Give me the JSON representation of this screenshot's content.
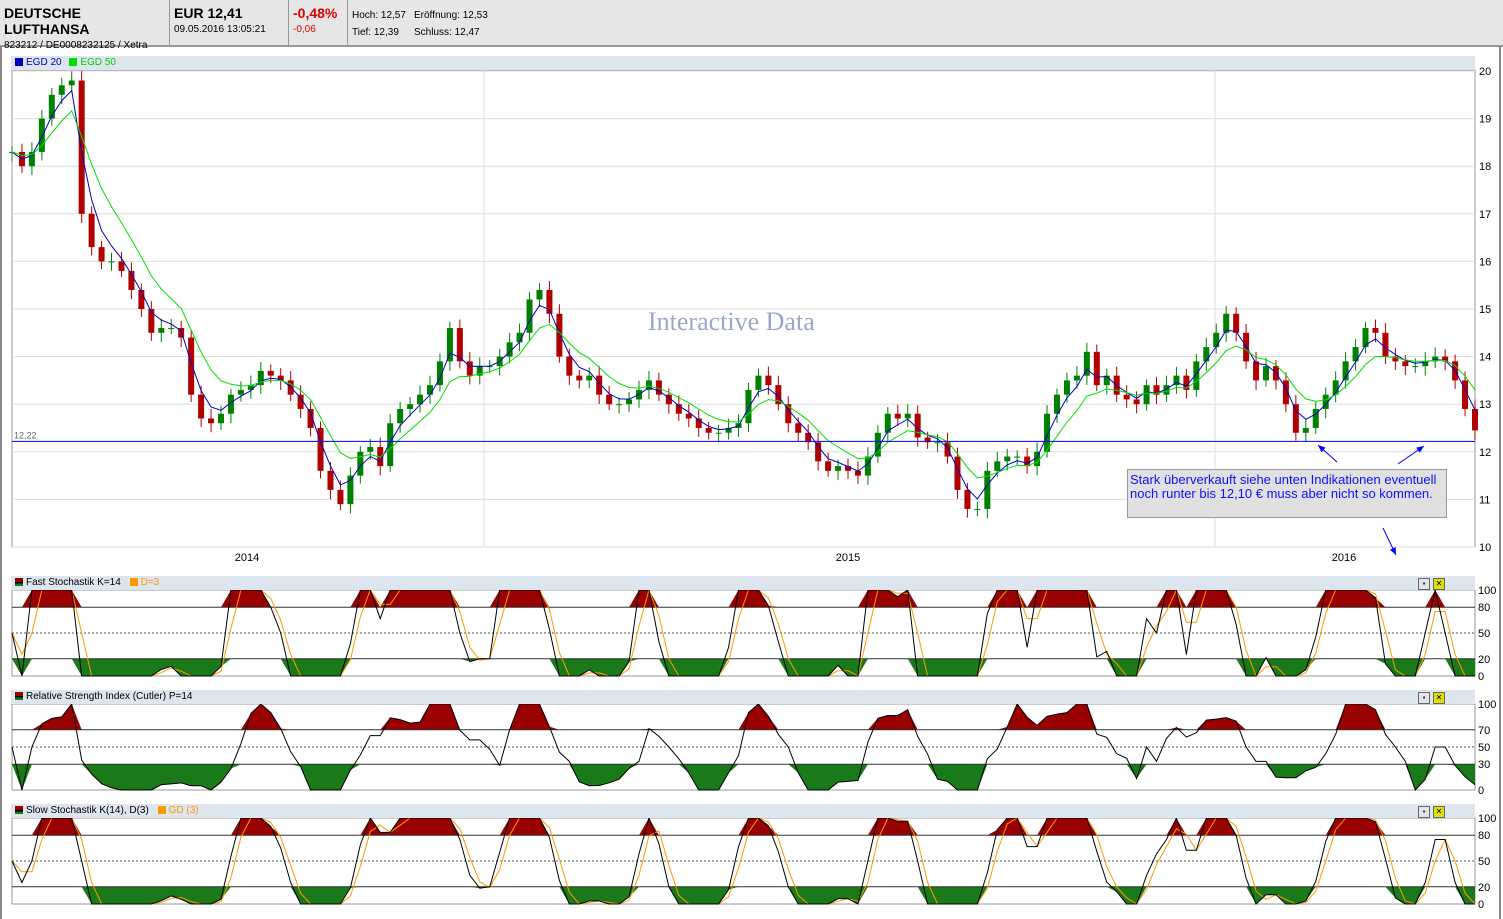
{
  "header": {
    "name": "DEUTSCHE LUFTHANSA",
    "ids": "823212 / DE0008232125 / Xetra",
    "price": "EUR 12,41",
    "datetime": "09.05.2016 13:05:21",
    "change_pct": "-0,48%",
    "change_abs": "-0,06",
    "hoch": "Hoch: 12,57",
    "tief": "Tief: 12,39",
    "eroeffnung": "Eröffnung: 12,53",
    "schluss": "Schluss: 12,47"
  },
  "watermark": "Interactive Data",
  "annotation": "Stark überverkauft siehe unten Indikationen eventuell noch runter bis 12,10 € muss aber nicht so kommen.",
  "colors": {
    "ema20": "#0000c0",
    "ema50": "#00e000",
    "up": "#008000",
    "down": "#b00000",
    "overbought": "#990000",
    "oversold": "#1a7a1a",
    "signal": "#ff9900",
    "hline": "#0000ff"
  },
  "chart_data": [
    {
      "type": "candlestick",
      "title": "",
      "legend": [
        {
          "name": "EGD 20",
          "color": "#0000c0"
        },
        {
          "name": "EGD 50",
          "color": "#00e000"
        }
      ],
      "ylim": [
        10,
        20
      ],
      "yticks": [
        10,
        11,
        12,
        13,
        14,
        15,
        16,
        17,
        18,
        19,
        20
      ],
      "xticks": [
        "2014",
        "2015",
        "2016"
      ],
      "hline": {
        "value": 12.22,
        "label": "12,22"
      },
      "closes": [
        18.3,
        18.0,
        18.3,
        19.0,
        19.5,
        19.7,
        19.8,
        17.0,
        16.3,
        16.0,
        16.0,
        15.8,
        15.4,
        15.0,
        14.5,
        14.6,
        14.6,
        14.4,
        13.2,
        12.7,
        12.6,
        12.8,
        13.2,
        13.3,
        13.4,
        13.7,
        13.6,
        13.5,
        13.2,
        12.9,
        12.5,
        11.6,
        11.2,
        10.9,
        11.5,
        12.0,
        12.1,
        11.7,
        12.6,
        12.9,
        13.0,
        13.2,
        13.4,
        13.9,
        14.6,
        13.9,
        13.6,
        13.8,
        13.8,
        14.0,
        14.3,
        14.5,
        15.2,
        15.4,
        14.9,
        14.0,
        13.6,
        13.5,
        13.6,
        13.2,
        13.0,
        13.0,
        13.1,
        13.3,
        13.5,
        13.2,
        13.0,
        12.8,
        12.7,
        12.5,
        12.4,
        12.4,
        12.5,
        12.6,
        13.3,
        13.6,
        13.4,
        13.0,
        12.6,
        12.4,
        12.2,
        11.8,
        11.6,
        11.7,
        11.6,
        11.5,
        11.9,
        12.4,
        12.8,
        12.7,
        12.8,
        12.3,
        12.2,
        12.2,
        11.9,
        11.2,
        10.8,
        10.8,
        11.6,
        11.8,
        11.9,
        11.9,
        11.7,
        12.0,
        12.8,
        13.2,
        13.5,
        13.6,
        14.1,
        13.4,
        13.6,
        13.2,
        13.1,
        13.0,
        13.4,
        13.2,
        13.4,
        13.6,
        13.3,
        13.9,
        14.2,
        14.5,
        14.9,
        14.5,
        13.9,
        13.5,
        13.8,
        13.5,
        13.0,
        12.4,
        12.5,
        12.9,
        13.2,
        13.5,
        13.9,
        14.2,
        14.6,
        14.5,
        14.0,
        13.9,
        13.8,
        13.8,
        13.9,
        14.0,
        13.9,
        13.5,
        12.9,
        12.45
      ]
    },
    {
      "type": "line",
      "title": "Fast Stochastik K=14",
      "signal_label": "D=3",
      "ylim": [
        0,
        100
      ],
      "yticks": [
        0,
        20,
        50,
        80,
        100
      ]
    },
    {
      "type": "line",
      "title": "Relative Strength Index (Cutler) P=14",
      "ylim": [
        0,
        100
      ],
      "yticks": [
        0,
        30,
        50,
        70,
        100
      ]
    },
    {
      "type": "line",
      "title": "Slow Stochastik K(14), D(3)",
      "signal_label": "GD (3)",
      "ylim": [
        0,
        100
      ],
      "yticks": [
        0,
        20,
        50,
        80,
        100
      ]
    }
  ]
}
